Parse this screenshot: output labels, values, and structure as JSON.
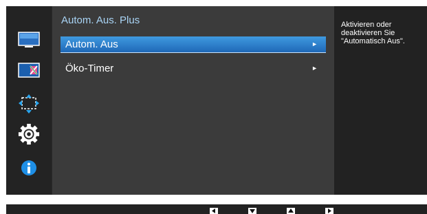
{
  "sidebar": {
    "items": [
      {
        "icon": "monitor-picture-icon"
      },
      {
        "icon": "color-screen-icon"
      },
      {
        "icon": "image-size-icon"
      },
      {
        "icon": "system-gear-icon",
        "active": true
      },
      {
        "icon": "information-icon"
      }
    ]
  },
  "menu": {
    "title": "Autom. Aus. Plus",
    "items": [
      {
        "label": "Autom. Aus",
        "arrow": "►",
        "selected": true
      },
      {
        "label": "Öko-Timer",
        "arrow": "►",
        "selected": false
      }
    ]
  },
  "help": {
    "text": "Aktivieren oder deaktivieren Sie \"Automatisch Aus\"."
  },
  "bottom_bar": {
    "buttons": [
      "left-arrow-icon",
      "down-arrow-icon",
      "up-arrow-icon",
      "right-arrow-icon"
    ]
  },
  "colors": {
    "title": "#a9d4f5",
    "selection": "#2f82d0",
    "info_icon": "#1e8fe6"
  }
}
